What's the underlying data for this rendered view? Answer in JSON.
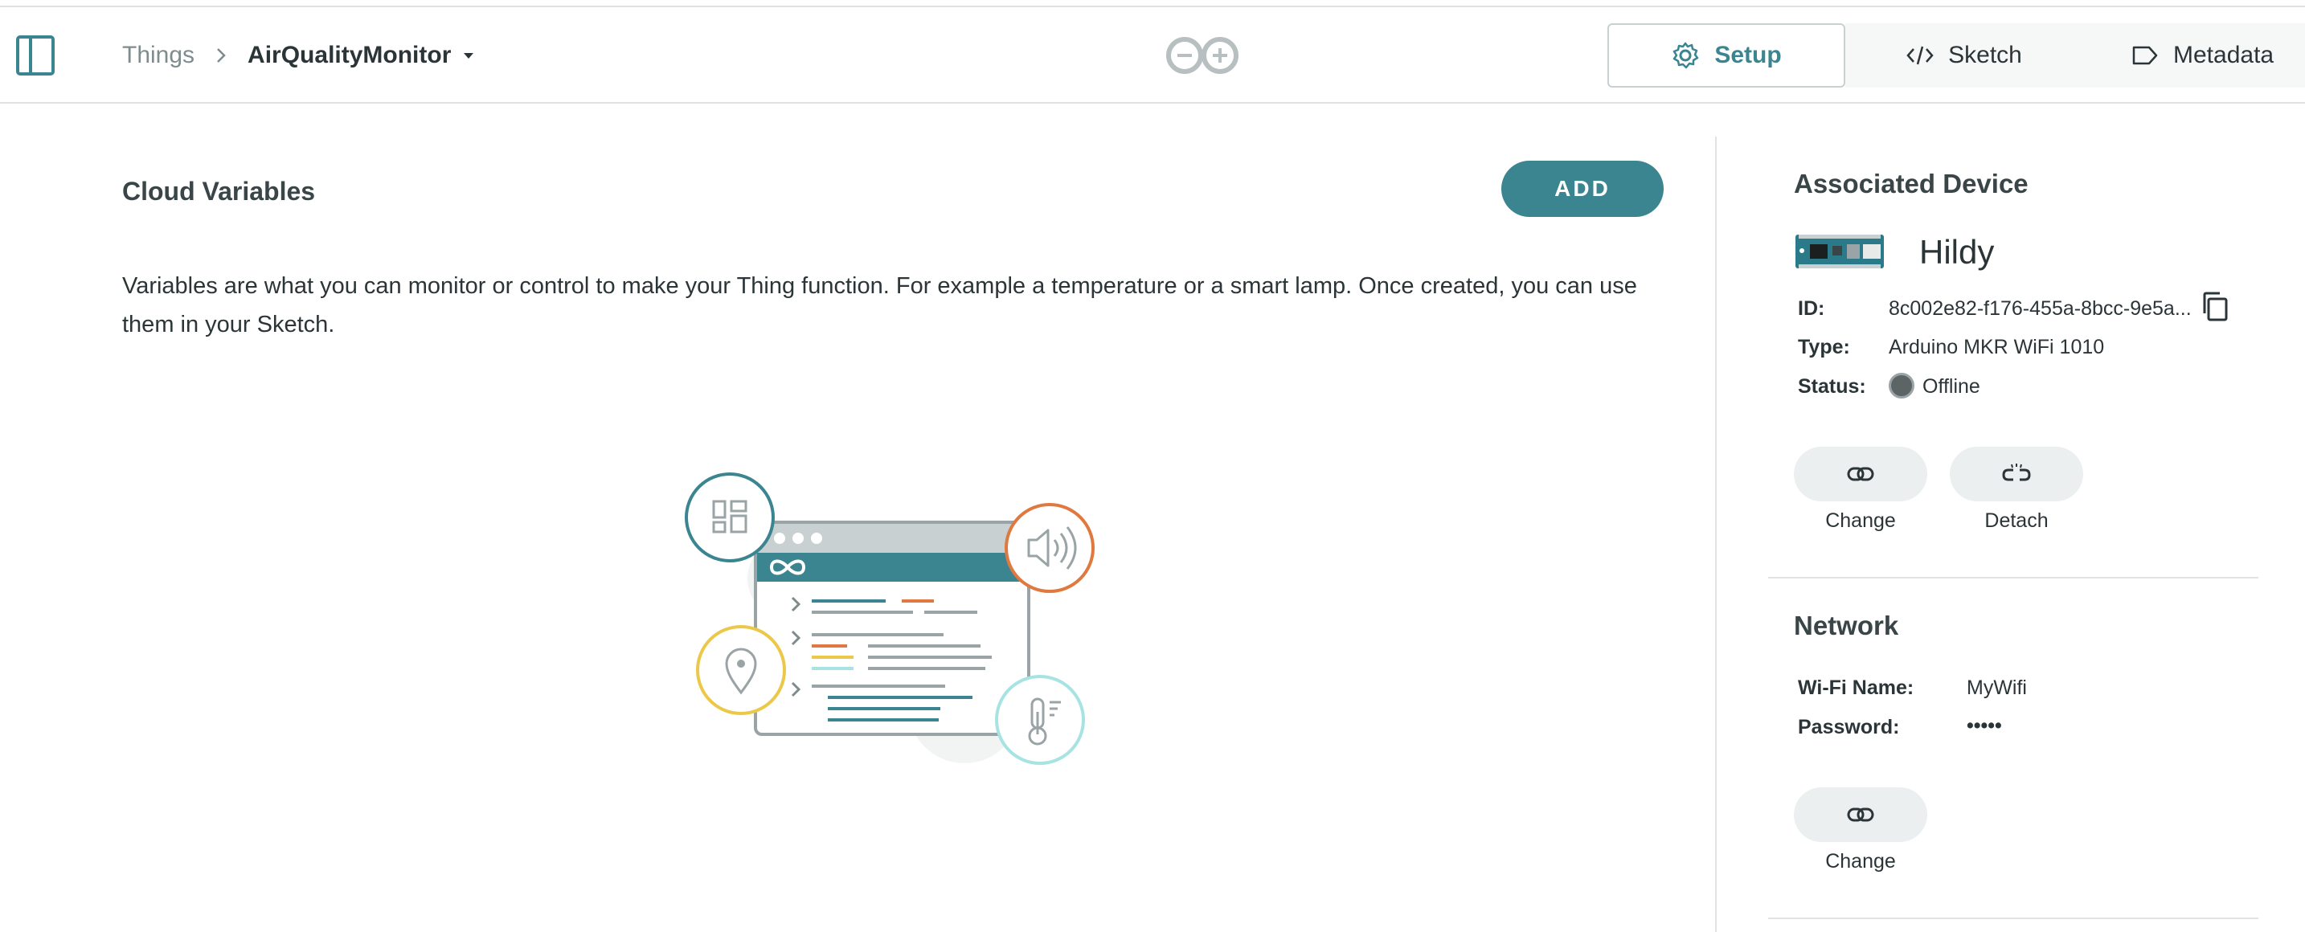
{
  "header": {
    "breadcrumb": {
      "root": "Things",
      "current": "AirQualityMonitor"
    },
    "tabs": [
      {
        "label": "Setup",
        "icon": "gear-icon",
        "active": true
      },
      {
        "label": "Sketch",
        "icon": "code-icon",
        "active": false
      },
      {
        "label": "Metadata",
        "icon": "tag-icon",
        "active": false
      }
    ]
  },
  "cloud_variables": {
    "title": "Cloud Variables",
    "add_label": "ADD",
    "description": "Variables are what you can monitor or control to make your Thing function. For example a temperature or a smart lamp. Once created, you can use them in your Sketch."
  },
  "associated_device": {
    "title": "Associated Device",
    "name": "Hildy",
    "id_label": "ID:",
    "id_value": "8c002e82-f176-455a-8bcc-9e5a...",
    "type_label": "Type:",
    "type_value": "Arduino MKR WiFi 1010",
    "status_label": "Status:",
    "status_value": "Offline",
    "change_label": "Change",
    "detach_label": "Detach"
  },
  "network": {
    "title": "Network",
    "wifi_label": "Wi-Fi Name:",
    "wifi_value": "MyWifi",
    "password_label": "Password:",
    "password_value": "•••••",
    "change_label": "Change"
  },
  "colors": {
    "accent": "#3b8590",
    "orange": "#e07940",
    "yellow": "#ecc84a",
    "aqua": "#a8e3e3",
    "status_offline": "#5c6466"
  }
}
